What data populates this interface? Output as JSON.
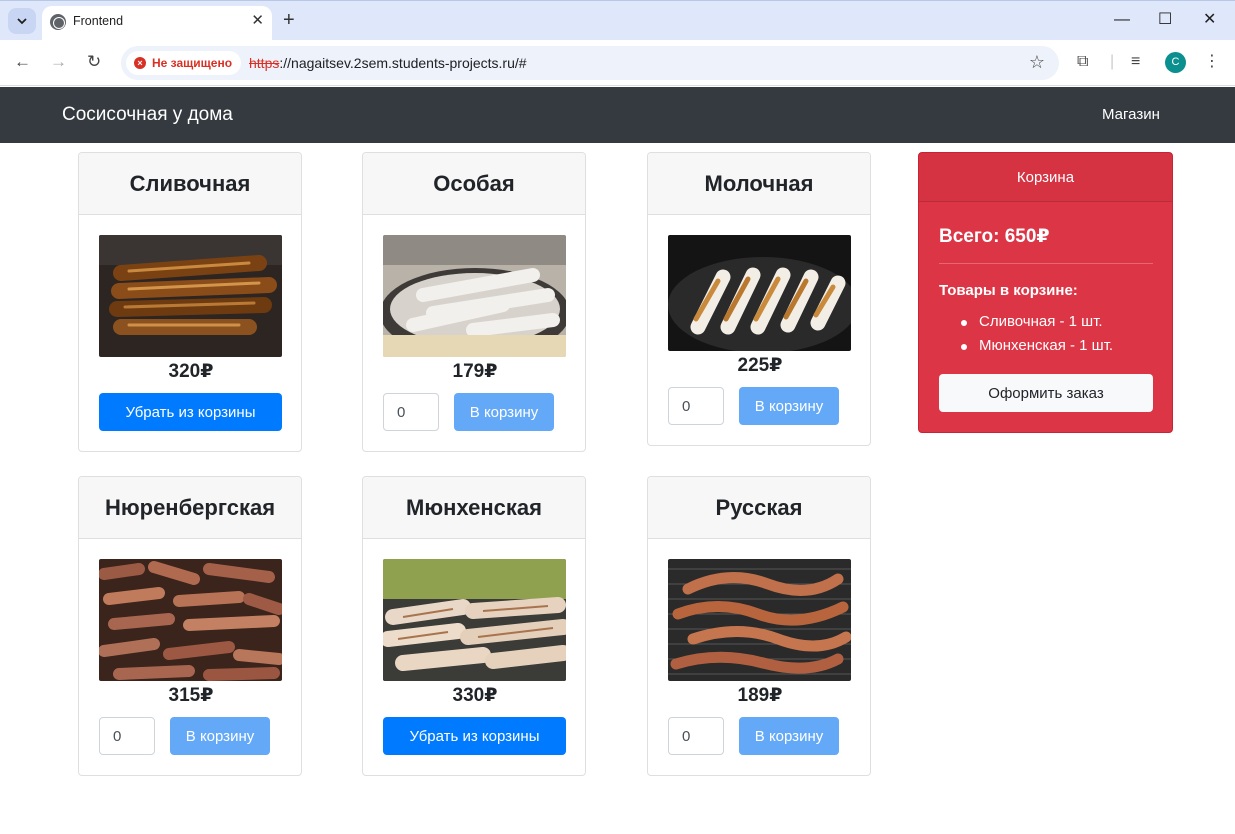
{
  "browser": {
    "tab_title": "Frontend",
    "security_label": "Не защищено",
    "url_scheme": "https",
    "url_rest": "://nagaitsev.2sem.students-projects.ru/#",
    "profile_initial": "C"
  },
  "site": {
    "brand": "Сосисочная у дома",
    "nav_link": "Магазин"
  },
  "products": [
    {
      "name": "Сливочная",
      "price": "320₽",
      "in_cart": true,
      "remove_label": "Убрать из корзины"
    },
    {
      "name": "Особая",
      "price": "179₽",
      "in_cart": false,
      "qty": "0",
      "add_label": "В корзину"
    },
    {
      "name": "Молочная",
      "price": "225₽",
      "in_cart": false,
      "qty": "0",
      "add_label": "В корзину"
    },
    {
      "name": "Нюренбергская",
      "price": "315₽",
      "in_cart": false,
      "qty": "0",
      "add_label": "В корзину"
    },
    {
      "name": "Мюнхенская",
      "price": "330₽",
      "in_cart": true,
      "remove_label": "Убрать из корзины"
    },
    {
      "name": "Русская",
      "price": "189₽",
      "in_cart": false,
      "qty": "0",
      "add_label": "В корзину"
    }
  ],
  "cart": {
    "title": "Корзина",
    "total": "Всего: 650₽",
    "items_title": "Товары в корзине:",
    "items": [
      "Сливочная - 1 шт.",
      "Мюнхенская - 1 шт."
    ],
    "checkout_label": "Оформить заказ"
  },
  "colors": {
    "navbar": "#343a40",
    "primary": "#007bff",
    "primary_light": "#63a9f8",
    "cart": "#dc3545"
  }
}
